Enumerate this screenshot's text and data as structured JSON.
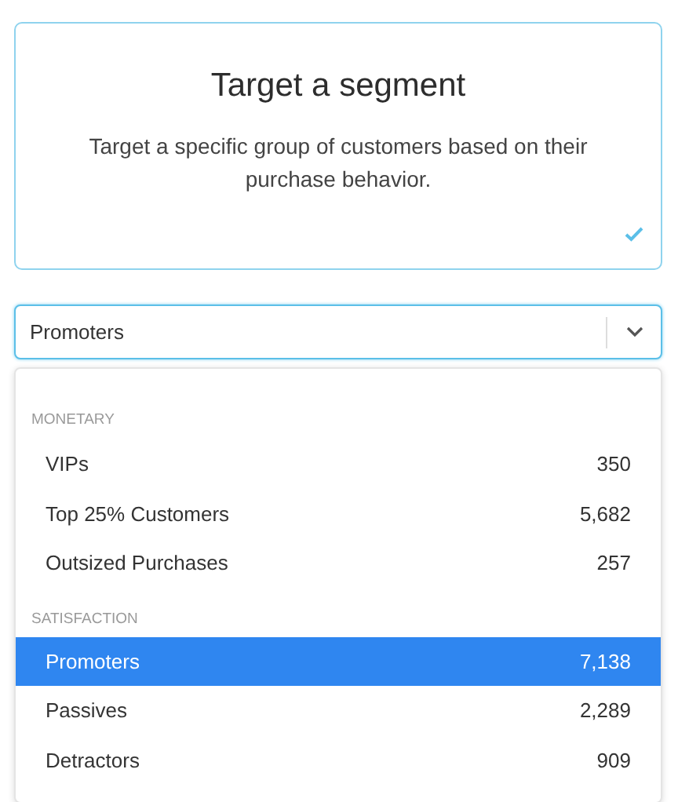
{
  "card": {
    "title": "Target a segment",
    "description": "Target a specific group of customers based on their purchase behavior.",
    "checked": true
  },
  "select": {
    "value": "Promoters",
    "expanded": true
  },
  "menu": {
    "groups": [
      {
        "label": "MONETARY",
        "options": [
          {
            "label": "VIPs",
            "count": "350",
            "selected": false
          },
          {
            "label": "Top 25% Customers",
            "count": "5,682",
            "selected": false
          },
          {
            "label": "Outsized Purchases",
            "count": "257",
            "selected": false
          }
        ]
      },
      {
        "label": "SATISFACTION",
        "options": [
          {
            "label": "Promoters",
            "count": "7,138",
            "selected": true
          },
          {
            "label": "Passives",
            "count": "2,289",
            "selected": false
          },
          {
            "label": "Detractors",
            "count": "909",
            "selected": false
          }
        ]
      }
    ]
  }
}
